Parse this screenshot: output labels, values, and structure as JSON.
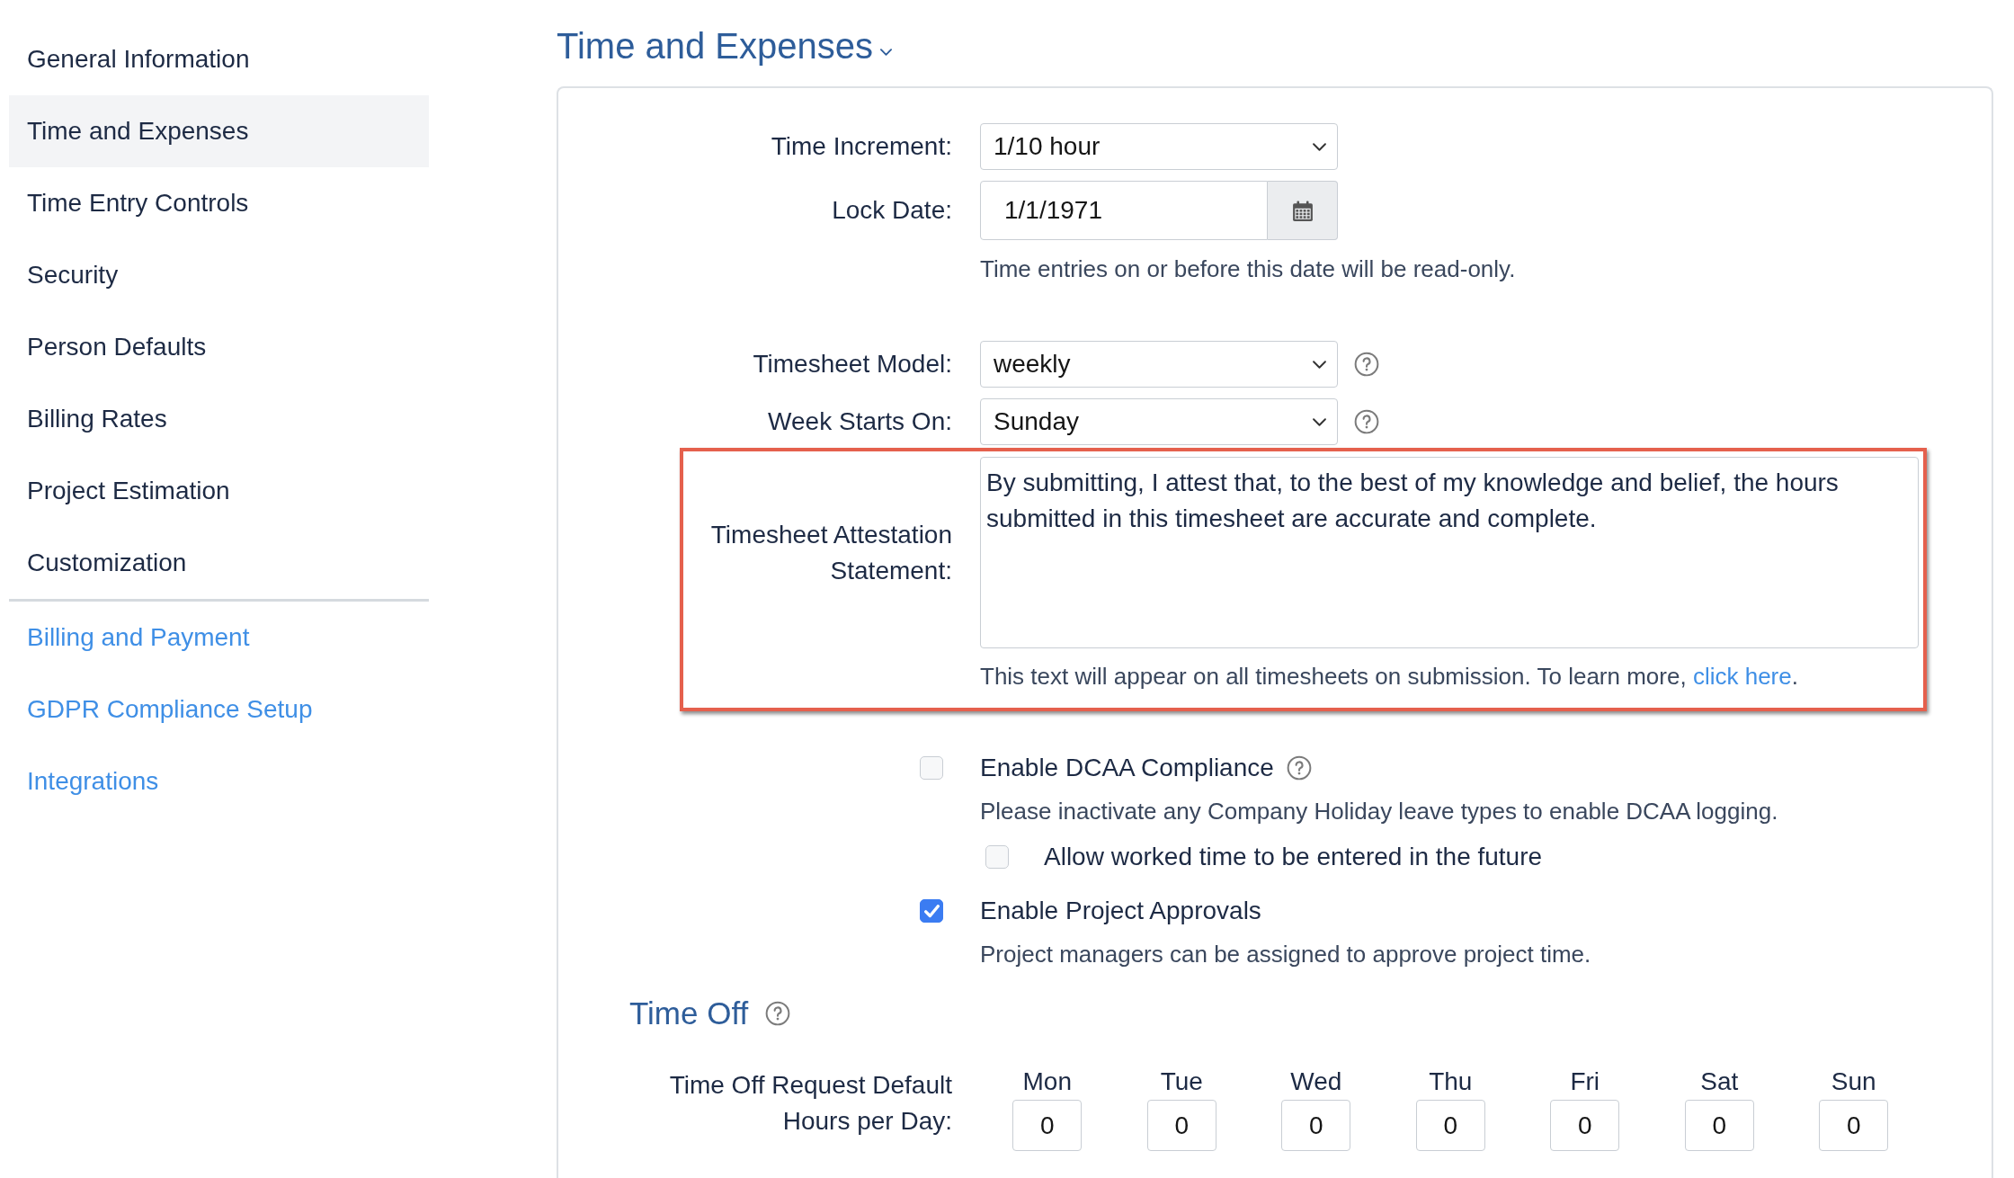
{
  "sidebar": {
    "items": [
      {
        "label": "General Information",
        "selected": false
      },
      {
        "label": "Time and Expenses",
        "selected": true
      },
      {
        "label": "Time Entry Controls",
        "selected": false
      },
      {
        "label": "Security",
        "selected": false
      },
      {
        "label": "Person Defaults",
        "selected": false
      },
      {
        "label": "Billing Rates",
        "selected": false
      },
      {
        "label": "Project Estimation",
        "selected": false
      },
      {
        "label": "Customization",
        "selected": false
      }
    ],
    "links": [
      {
        "label": "Billing and Payment"
      },
      {
        "label": "GDPR Compliance Setup"
      },
      {
        "label": "Integrations"
      }
    ]
  },
  "page_title": "Time and Expenses",
  "fields": [
    {
      "kind": "select",
      "label": "Time Increment:",
      "value": "1/10 hour",
      "help": false,
      "highlighted": false
    },
    {
      "kind": "date",
      "label": "Lock Date:",
      "value": "1/1/1971",
      "hint": "Time entries on or before this date will be read-only.",
      "help": false,
      "highlighted": false
    },
    {
      "kind": "select",
      "label": "Timesheet Model:",
      "value": "weekly",
      "help": true,
      "highlighted": false
    },
    {
      "kind": "select",
      "label": "Week Starts On:",
      "value": "Sunday",
      "help": true,
      "highlighted": false
    },
    {
      "kind": "textarea",
      "label": "Timesheet Attestation Statement:",
      "value": "By submitting, I attest that, to the best of my knowledge and belief, the hours submitted in this timesheet are accurate and complete.",
      "hint": "This text will appear on all timesheets on submission. To learn more,",
      "link": "click here",
      "hint_end": ".",
      "help": false,
      "highlighted": true
    }
  ],
  "options": [
    {
      "label": "Enable DCAA Compliance",
      "checked": false,
      "help": true,
      "hint": "Please inactivate any Company Holiday leave types to enable DCAA logging.",
      "children": [
        {
          "label": "Allow worked time to be entered in the future",
          "checked": false,
          "help": false
        }
      ]
    },
    {
      "label": "Enable Project Approvals",
      "checked": true,
      "help": false,
      "hint": "Project managers can be assigned to approve project time."
    }
  ],
  "time_off": {
    "title": "Time Off",
    "help": true,
    "label": "Time Off Request Default Hours per Day:",
    "days": [
      {
        "label": "Mon",
        "value": "0"
      },
      {
        "label": "Tue",
        "value": "0"
      },
      {
        "label": "Wed",
        "value": "0"
      },
      {
        "label": "Thu",
        "value": "0"
      },
      {
        "label": "Fri",
        "value": "0"
      },
      {
        "label": "Sat",
        "value": "0"
      },
      {
        "label": "Sun",
        "value": "0"
      }
    ]
  }
}
